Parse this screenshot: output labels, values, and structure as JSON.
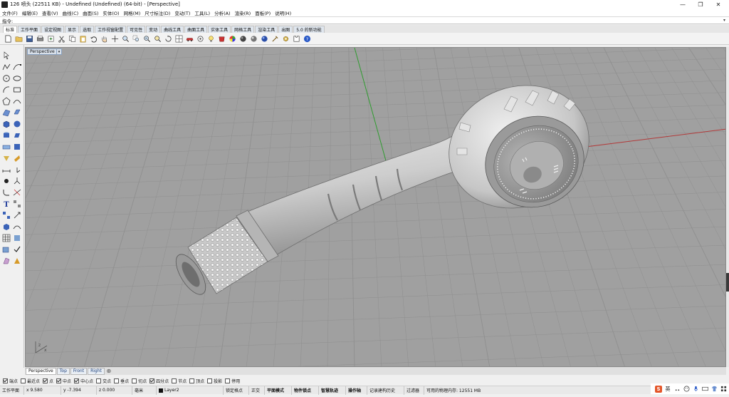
{
  "window": {
    "title": "126 喷头 (22511 KB) - Undefined (Undefined) (64-bit) - [Perspective]",
    "minimize": "—",
    "maximize": "❐",
    "close": "✕"
  },
  "menu": [
    "文件(F)",
    "编辑(E)",
    "查看(V)",
    "曲线(C)",
    "曲面(S)",
    "实体(O)",
    "网格(M)",
    "尺寸标注(D)",
    "变动(T)",
    "工具(L)",
    "分析(A)",
    "渲染(R)",
    "面板(P)",
    "说明(H)"
  ],
  "command": {
    "label": "指令:",
    "dropdown": "▾"
  },
  "toolbar_tabs": [
    "标准",
    "工作平面",
    "设定视图",
    "显示",
    "选取",
    "工作视窗配置",
    "可见性",
    "变动",
    "曲线工具",
    "曲面工具",
    "实体工具",
    "网格工具",
    "渲染工具",
    "出图",
    "5.0 的新功能"
  ],
  "toolbar_icons": [
    "new-file-icon",
    "open-file-icon",
    "save-icon",
    "print-icon",
    "import-icon",
    "cut-icon",
    "copy-icon",
    "paste-icon",
    "undo-icon",
    "pan-hand-icon",
    "pan-icon",
    "zoom-icon",
    "zoom-window-icon",
    "zoom-extents-icon",
    "zoom-selected-icon",
    "rotate-view-icon",
    "viewport-layout-icon",
    "car-icon",
    "point-icon",
    "lightbulb-icon",
    "material-icon",
    "color-wheel-icon",
    "sphere-dark-icon",
    "sphere-render-icon",
    "sphere-blue-icon",
    "tools-icon",
    "gear-icon",
    "puzzle-icon",
    "help-icon"
  ],
  "viewport": {
    "label": "Perspective",
    "dropdown": "▾",
    "axis_icon": "world-axes-icon"
  },
  "view_tabs": [
    "Perspective",
    "Top",
    "Front",
    "Right"
  ],
  "view_tab_add": "⊕",
  "osnaps": [
    {
      "label": "端点",
      "checked": true
    },
    {
      "label": "最近点",
      "checked": false
    },
    {
      "label": "点",
      "checked": true
    },
    {
      "label": "中点",
      "checked": true
    },
    {
      "label": "中心点",
      "checked": true
    },
    {
      "label": "交点",
      "checked": false
    },
    {
      "label": "垂点",
      "checked": false
    },
    {
      "label": "切点",
      "checked": false
    },
    {
      "label": "四分点",
      "checked": true
    },
    {
      "label": "节点",
      "checked": false
    },
    {
      "label": "顶点",
      "checked": false
    },
    {
      "label": "投影",
      "checked": false
    },
    {
      "label": "停用",
      "checked": false
    }
  ],
  "status": {
    "cplane": "工作平面",
    "x": "x 9.580",
    "y": "y -7.394",
    "z": "z 0.000",
    "unit": "毫米",
    "layer": "Layer2",
    "grid_snap": "锁定格点",
    "ortho": "正交",
    "planar": "平面模式",
    "osnap": "物件锁点",
    "smarttrack": "智慧轨迹",
    "gumball": "操作轴",
    "history": "记录建构历史",
    "filter": "过滤器",
    "memory": "可用的物理内存: 12551 MB"
  },
  "tray": {
    "ime": "S",
    "lang": "英",
    "icons": [
      "punctuation-icon",
      "emoji-icon",
      "microphone-icon",
      "keyboard-icon",
      "shirt-icon",
      "grid-icon"
    ]
  },
  "colors": {
    "viewport_bg": "#a0a0a0",
    "grid_line": "#8f8f8f",
    "x_axis": "#b23a3a",
    "y_axis": "#2f9b2f",
    "model": "#d9d9d9"
  }
}
